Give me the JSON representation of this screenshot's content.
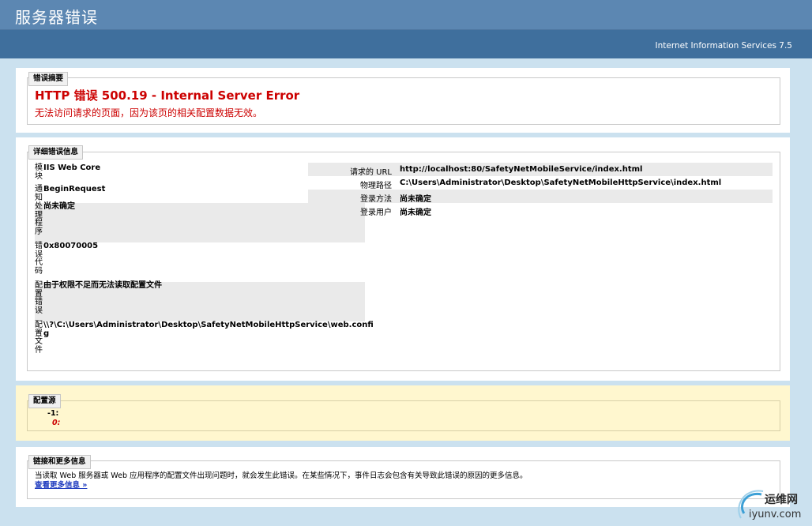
{
  "header": {
    "title": "服务器错误",
    "product": "Internet Information Services 7.5"
  },
  "summary": {
    "legend": "错误摘要",
    "error_title": "HTTP 错误 500.19 - Internal Server Error",
    "error_desc": "无法访问请求的页面，因为该页的相关配置数据无效。"
  },
  "details": {
    "legend": "详细错误信息",
    "left": [
      {
        "label": "模块",
        "value": "IIS Web Core"
      },
      {
        "label": "通知",
        "value": "BeginRequest"
      },
      {
        "label": "处理程序",
        "value": "尚未确定"
      },
      {
        "label": "错误代码",
        "value": "0x80070005"
      },
      {
        "label": "配置错误",
        "value": "由于权限不足而无法读取配置文件"
      },
      {
        "label": "配置文件",
        "value": "\\\\?\\C:\\Users\\Administrator\\Desktop\\SafetyNetMobileHttpService\\web.config"
      }
    ],
    "right": [
      {
        "label": "请求的 URL",
        "value": "http://localhost:80/SafetyNetMobileService/index.html"
      },
      {
        "label": "物理路径",
        "value": "C:\\Users\\Administrator\\Desktop\\SafetyNetMobileHttpService\\index.html"
      },
      {
        "label": "登录方法",
        "value": "尚未确定"
      },
      {
        "label": "登录用户",
        "value": "尚未确定"
      }
    ]
  },
  "config": {
    "legend": "配置源",
    "line1": "-1:",
    "line2": "0:"
  },
  "links": {
    "legend": "链接和更多信息",
    "desc": "当读取 Web 服务器或 Web 应用程序的配置文件出现问题时，就会发生此错误。在某些情况下，事件日志会包含有关导致此错误的原因的更多信息。",
    "more": "查看更多信息 »"
  },
  "watermark": {
    "name": "运维网",
    "url": "iyunv.com"
  }
}
